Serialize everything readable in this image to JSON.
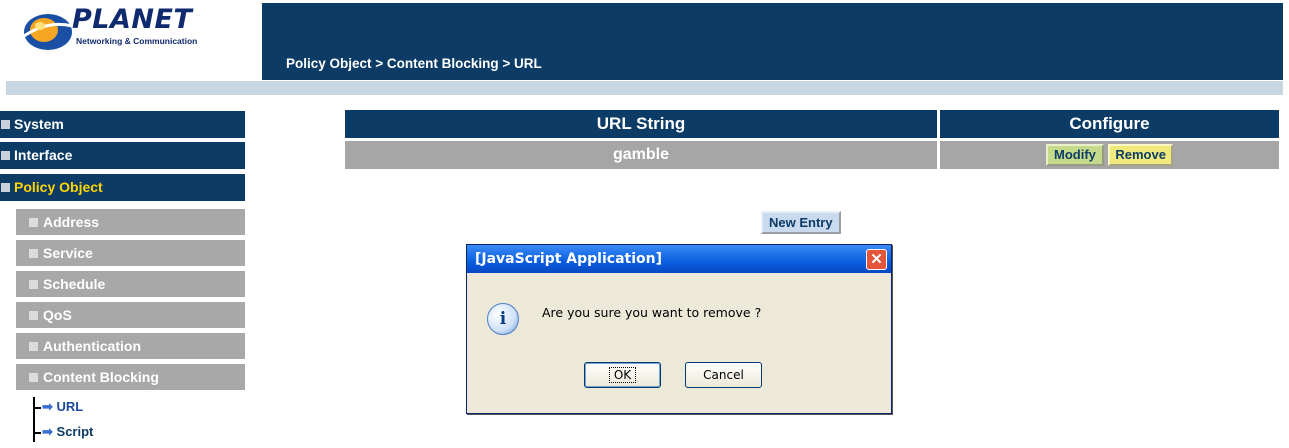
{
  "brand": {
    "name": "PLANET",
    "tagline": "Networking & Communication"
  },
  "header": {
    "breadcrumb": "Policy Object > Content Blocking > URL"
  },
  "sidebar": {
    "main": [
      {
        "label": "System"
      },
      {
        "label": "Interface"
      },
      {
        "label": "Policy Object"
      }
    ],
    "sub": [
      {
        "label": "Address"
      },
      {
        "label": "Service"
      },
      {
        "label": "Schedule"
      },
      {
        "label": "QoS"
      },
      {
        "label": "Authentication"
      },
      {
        "label": "Content Blocking"
      }
    ],
    "tree": [
      {
        "label": "URL"
      },
      {
        "label": "Script"
      }
    ]
  },
  "table": {
    "headers": {
      "url": "URL String",
      "configure": "Configure"
    },
    "rows": [
      {
        "url": "gamble",
        "modify": "Modify",
        "remove": "Remove"
      }
    ]
  },
  "new_entry_label": "New Entry",
  "dialog": {
    "title": "[JavaScript Application]",
    "message": "Are you sure you want to remove ?",
    "ok": "OK",
    "cancel": "Cancel",
    "icon": "i"
  },
  "colors": {
    "navy": "#0c3b66",
    "gray": "#a6a6a6",
    "active": "#ffd600"
  }
}
